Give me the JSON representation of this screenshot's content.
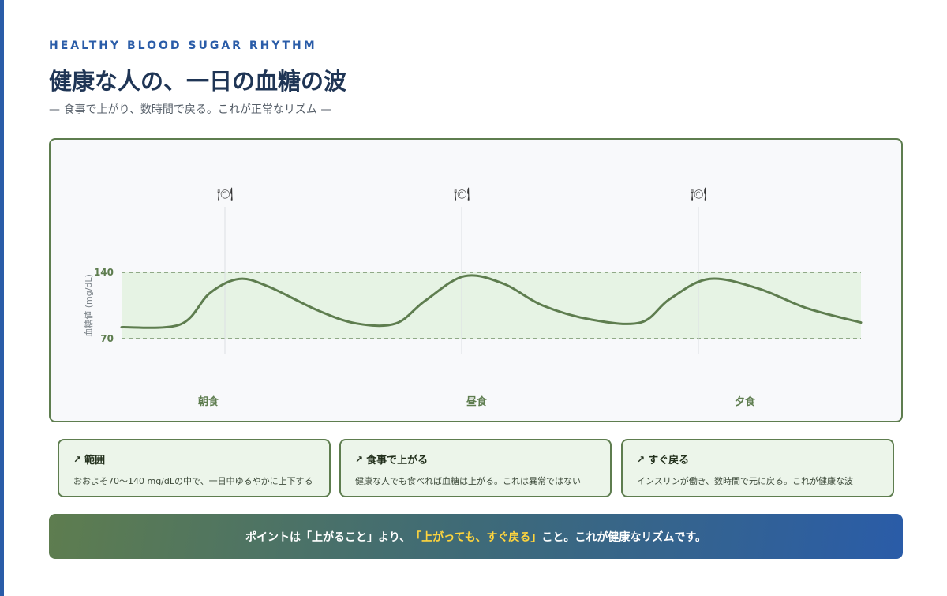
{
  "header": {
    "eyebrow": "HEALTHY BLOOD SUGAR RHYTHM",
    "title": "健康な人の、一日の血糖の波",
    "subtitle": "— 食事で上がり、数時間で戻る。これが正常なリズム —"
  },
  "chart_data": {
    "type": "line",
    "ylabel": "血糖値 (mg/dL)",
    "normal_band": [
      70,
      140
    ],
    "y_ticks": [
      140,
      70
    ],
    "meals": [
      {
        "label": "朝食",
        "icon": "🍽"
      },
      {
        "label": "昼食",
        "icon": "🍽"
      },
      {
        "label": "夕食",
        "icon": "🍽"
      }
    ],
    "series": [
      {
        "color": "#5e7d4f",
        "points": [
          [
            0,
            82
          ],
          [
            0.6,
            85
          ],
          [
            0.9,
            118
          ],
          [
            1.2,
            133
          ],
          [
            1.5,
            125
          ],
          [
            2,
            100
          ],
          [
            2.4,
            86
          ],
          [
            2.8,
            86
          ],
          [
            3.1,
            110
          ],
          [
            3.5,
            136
          ],
          [
            3.9,
            128
          ],
          [
            4.3,
            105
          ],
          [
            4.8,
            90
          ],
          [
            5.3,
            87
          ],
          [
            5.6,
            112
          ],
          [
            6,
            133
          ],
          [
            6.5,
            123
          ],
          [
            7,
            102
          ],
          [
            7.55,
            87
          ]
        ]
      }
    ],
    "colors": {
      "line": "#5e7d4f",
      "band": "#e6f3e4",
      "band_border": "#5e7d4f"
    }
  },
  "cards": [
    {
      "icon": "↗",
      "title": "範囲",
      "body": "おおよそ70〜140 mg/dLの中で、一日中ゆるやかに上下する"
    },
    {
      "icon": "↗",
      "title": "食事で上がる",
      "body": "健康な人でも食べれば血糖は上がる。これは異常ではない"
    },
    {
      "icon": "↗",
      "title": "すぐ戻る",
      "body": "インスリンが働き、数時間で元に戻る。これが健康な波"
    }
  ],
  "banner": {
    "pre": "ポイントは「上がること」より、",
    "highlight": "「上がっても、すぐ戻る」",
    "post": "こと。これが健康なリズムです。"
  }
}
